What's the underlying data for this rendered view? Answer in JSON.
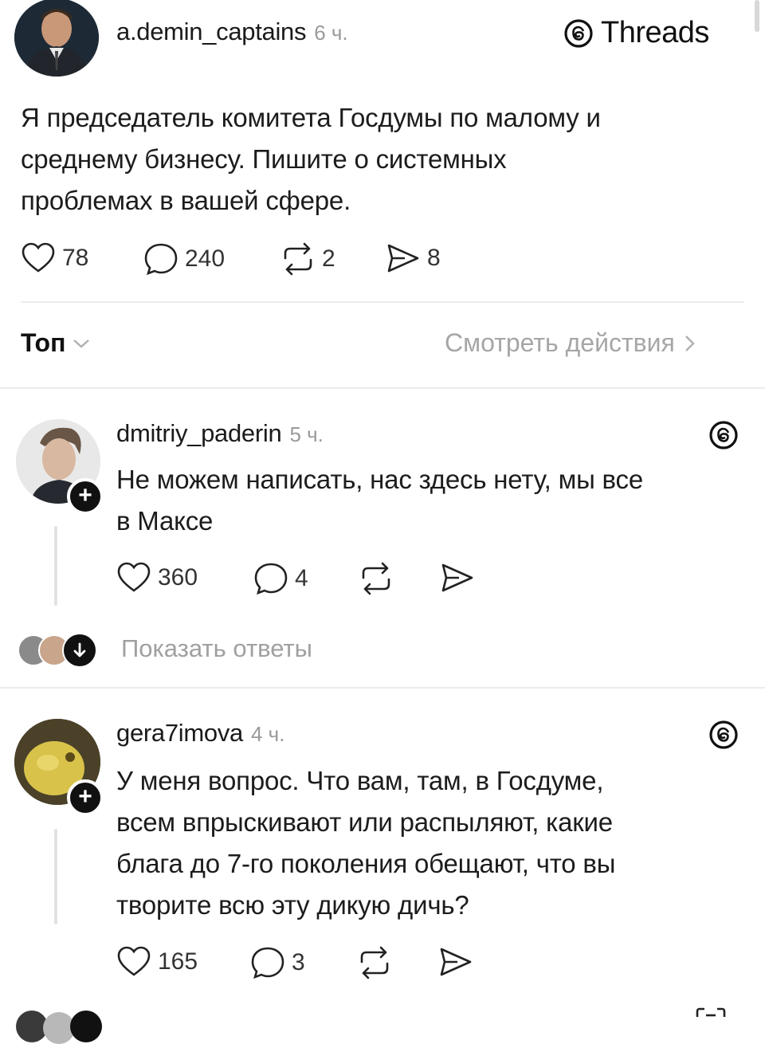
{
  "post": {
    "author": "a.demin_captains",
    "time": "6 ч.",
    "brand": "Threads",
    "text_lines": [
      "Я председатель комитета Госдумы по малому и",
      "среднему бизнесу. Пишите о системных",
      "проблемах в вашей сфере."
    ],
    "likes": "78",
    "comments": "240",
    "reposts": "2",
    "shares": "8"
  },
  "sort": {
    "label": "Топ",
    "view_activity": "Смотреть действия"
  },
  "replies": [
    {
      "author": "dmitriy_paderin",
      "time": "5 ч.",
      "text_lines": [
        "Не можем написать, нас здесь нету, мы все",
        "в Максе"
      ],
      "likes": "360",
      "comments": "4",
      "show_replies": "Показать ответы"
    },
    {
      "author": "gera7imova",
      "time": "4 ч.",
      "text_lines": [
        "У меня вопрос. Что вам, там, в Госдуме,",
        "всем впрыскивают или распыляют, какие",
        "блага до 7-го поколения обещают, что вы",
        "творите всю эту дикую дичь?"
      ],
      "likes": "165",
      "comments": "3"
    }
  ],
  "colors": {
    "text": "#111111",
    "muted": "#9a9a9a",
    "divider": "#ececec"
  },
  "icons": [
    "heart-icon",
    "comment-icon",
    "repost-icon",
    "share-icon",
    "threads-logo-icon",
    "chevron-down-icon",
    "chevron-right-icon",
    "plus-icon",
    "arrow-down-icon"
  ]
}
